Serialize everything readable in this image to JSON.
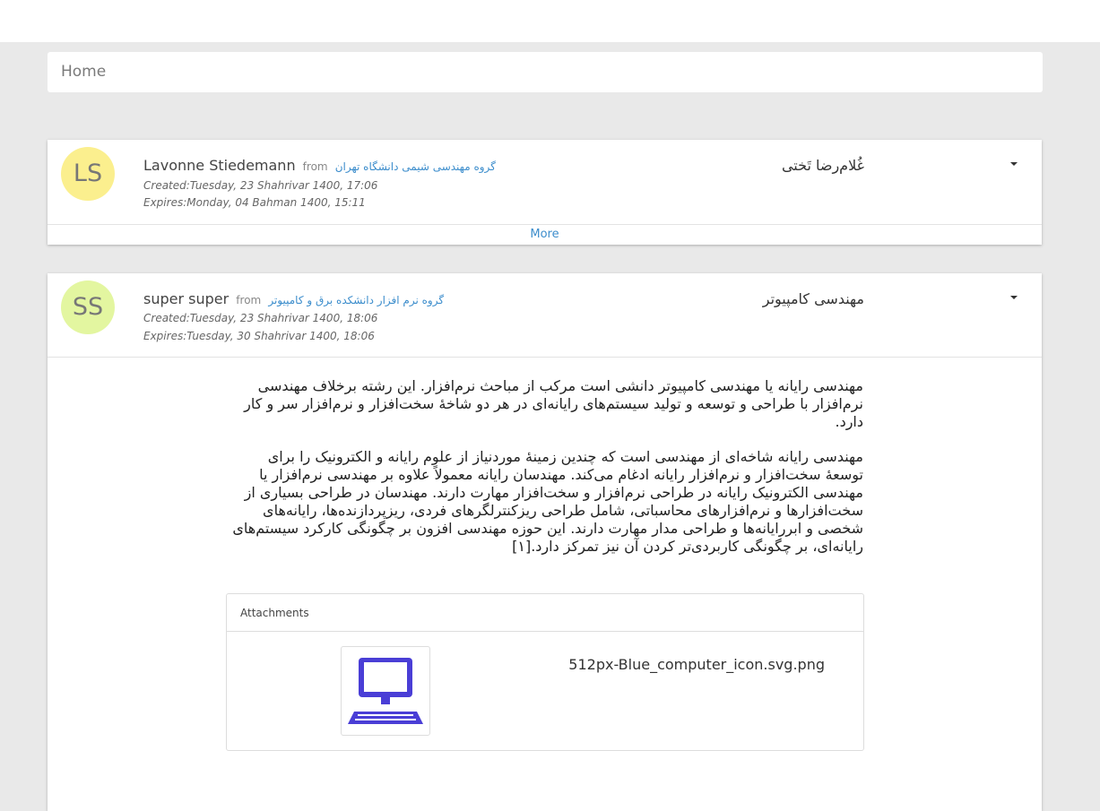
{
  "breadcrumb": {
    "home": "Home"
  },
  "messages": [
    {
      "initials": "LS",
      "sender": "Lavonne Stiedemann",
      "from_label": "from",
      "group": "گروه مهندسی شیمی دانشگاه تهران",
      "created": "Created:Tuesday, 23 Shahrivar 1400, 17:06",
      "expires": "Expires:Monday, 04 Bahman 1400, 15:11",
      "subject": "غُلام‌رضا تَختی",
      "more_label": "More"
    },
    {
      "initials": "SS",
      "sender": "super super",
      "from_label": "from",
      "group": "گروه نرم افزار دانشکده برق و کامپیوتر",
      "created": "Created:Tuesday, 23 Shahrivar 1400, 18:06",
      "expires": "Expires:Tuesday, 30 Shahrivar 1400, 18:06",
      "subject": "مهندسی کامپیوتر",
      "body_p1": "مهندسی رایانه یا مهندسی کامپیوتر دانشی است مرکب از مباحث نرم‌افزار. این رشته برخلاف مهندسی نرم‌افزار با طراحی و توسعه و تولید سیستم‌های رایانه‌ای در هر دو شاخهٔ سخت‌افزار و نرم‌افزار سر و کار دارد.",
      "body_p2": "مهندسی رایانه شاخه‌ای از مهندسی است که چندین زمینهٔ موردنیاز از علوم رایانه و الکترونیک را برای توسعهٔ سخت‌افزار و نرم‌افزار رایانه ادغام می‌کند. مهندسان رایانه معمولاً علاوه بر مهندسی نرم‌افزار یا مهندسی الکترونیک رایانه در طراحی نرم‌افزار و سخت‌افزار مهارت دارند. مهندسان در طراحی بسیاری از سخت‌افزارها و نرم‌افزارهای محاسباتی، شامل طراحی ریزکنترلگرهای فردی، ریزپردازنده‌ها، رایانه‌های شخصی و ابررایانه‌ها و طراحی مدار مهارت دارند. این حوزه مهندسی افزون بر چگونگی کارکرد سیستم‌های رایانه‌ای، بر چگونگی کاربردی‌تر کردن آن نیز تمرکز دارد.[۱]",
      "attachments_title": "Attachments",
      "attachment_name": "512px-Blue_computer_icon.svg.png"
    }
  ],
  "colors": {
    "link": "#3c8dcc",
    "avatar_ls": "#fbef8e",
    "avatar_ss": "#e3f6a0",
    "computer_icon": "#4a3ed6"
  },
  "icons": {
    "attachment_thumbnail": "computer-icon",
    "menu_toggle": "caret-down-icon"
  }
}
